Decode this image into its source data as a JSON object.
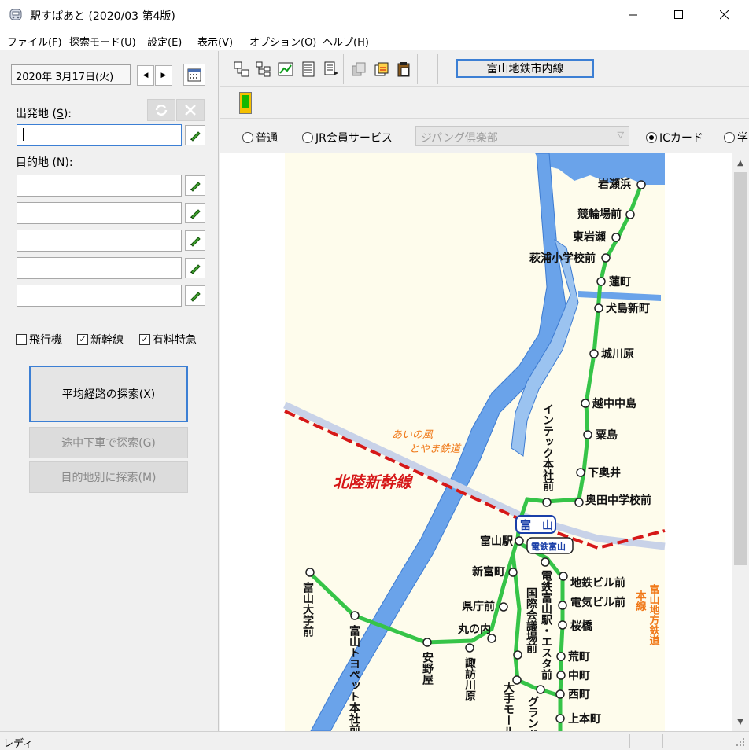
{
  "window": {
    "title": "駅すぱあと (2020/03 第4版)"
  },
  "menu": [
    "ファイル(F)",
    "探索モード(U)",
    "設定(E)",
    "表示(V)",
    "オプション(O)",
    "ヘルプ(H)"
  ],
  "left": {
    "date": "2020年  3月17日(火)",
    "departure_label": "出発地",
    "departure_key": "S",
    "destination_label": "目的地",
    "destination_key": "N",
    "departure_value": "",
    "destinations": [
      "",
      "",
      "",
      "",
      ""
    ],
    "checks": [
      {
        "label": "飛行機",
        "checked": false
      },
      {
        "label": "新幹線",
        "checked": true
      },
      {
        "label": "有料特急",
        "checked": true
      }
    ],
    "buttons": {
      "average": "平均経路の探索(X)",
      "stopover": "途中下車で探索(G)",
      "by_destination": "目的地別に探索(M)"
    }
  },
  "toolbar": {
    "line_button": "富山地鉄市内線"
  },
  "fares": {
    "options": [
      {
        "label": "普通",
        "selected": false
      },
      {
        "label": "JR会員サービス",
        "selected": false
      },
      {
        "label": "ICカード",
        "selected": true
      },
      {
        "label": "学",
        "selected": false
      }
    ],
    "combo_value": "ジパング倶楽部"
  },
  "map": {
    "shinkansen_label": "北陸新幹線",
    "ainokaze_label": [
      "あいの風",
      "とやま鉄道"
    ],
    "chitetsu_label": [
      "富山地方鉄道",
      "本線"
    ],
    "badge_toyama": "富　山",
    "badge_dentetsu": "電鉄富山",
    "stations_north": [
      "岩瀬浜",
      "競輪場前",
      "東岩瀬",
      "萩浦小学校前",
      "蓮町",
      "犬島新町",
      "城川原",
      "越中中島",
      "粟島",
      "下奥井",
      "奥田中学校前"
    ],
    "station_intec": "インテック本社前",
    "stations_city": [
      "富山駅",
      "新富町",
      "県庁前",
      "丸の内",
      "地鉄ビル前",
      "電気ビル前",
      "桜橋",
      "荒町",
      "中町",
      "西町",
      "上本町"
    ],
    "stations_vertical": [
      "富山大学前",
      "富山トヨペット本社前",
      "安野屋",
      "諏訪川原",
      "国際会議場前",
      "電鉄富山駅・エスタ前",
      "大手モール",
      "グランドプラザ前"
    ]
  },
  "status": {
    "text": "レディ"
  }
}
